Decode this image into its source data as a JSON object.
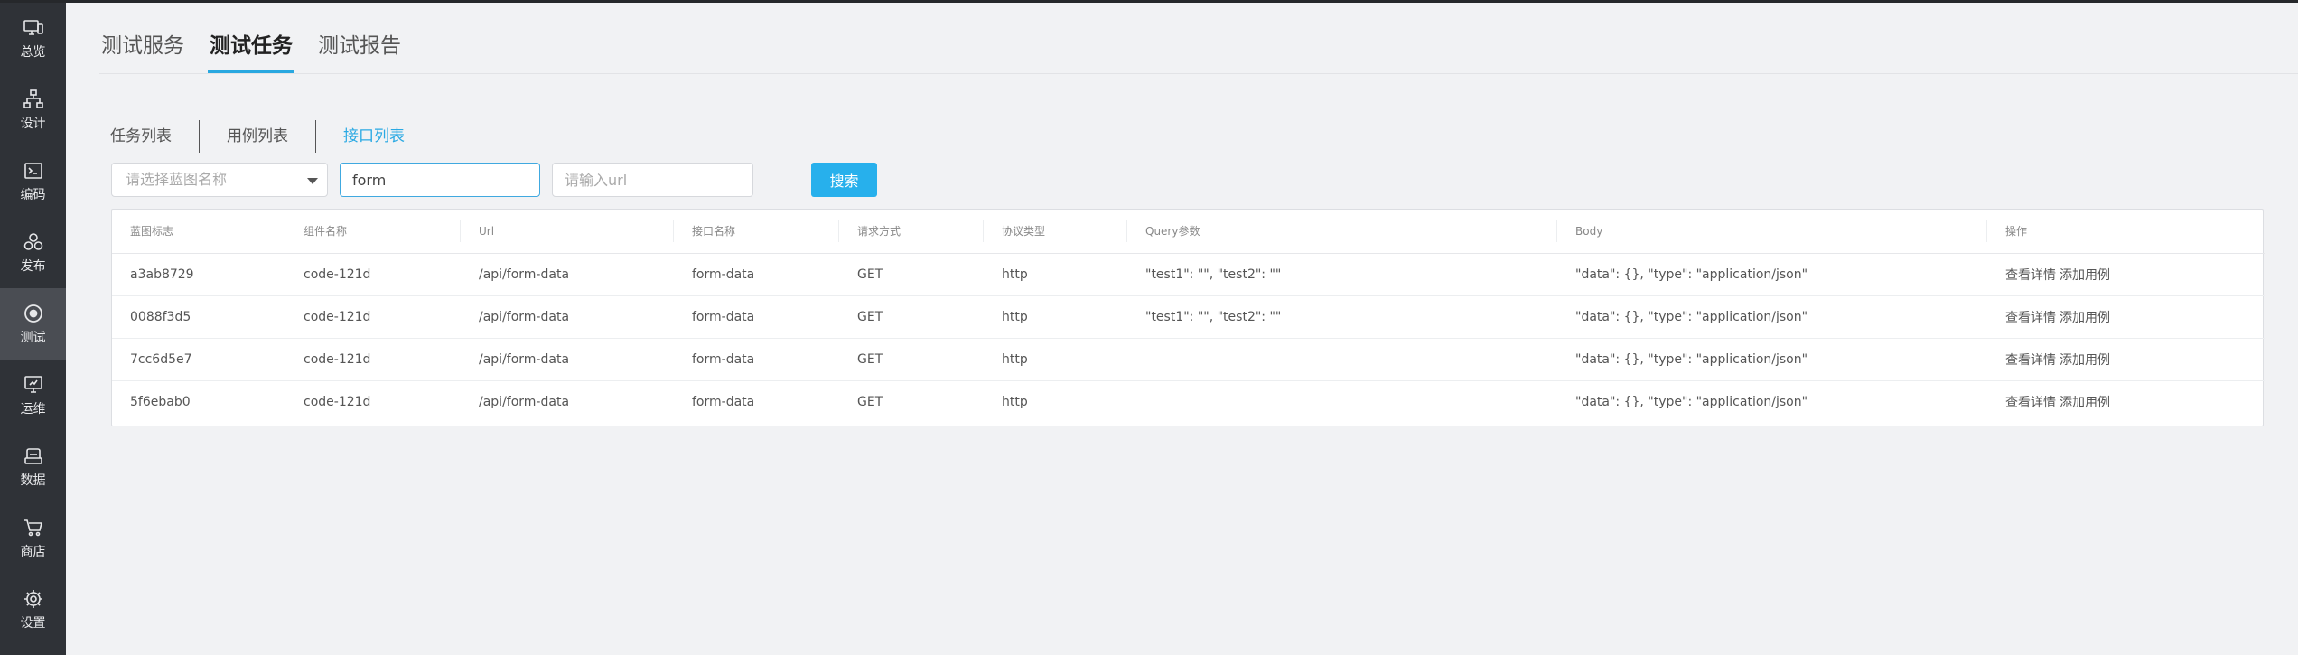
{
  "sidebar": {
    "items": [
      {
        "label": "总览",
        "icon": "monitor-icon"
      },
      {
        "label": "设计",
        "icon": "sitemap-icon"
      },
      {
        "label": "编码",
        "icon": "terminal-icon"
      },
      {
        "label": "发布",
        "icon": "circles-icon"
      },
      {
        "label": "测试",
        "icon": "target-icon"
      },
      {
        "label": "运维",
        "icon": "ops-monitor-icon"
      },
      {
        "label": "数据",
        "icon": "database-icon"
      },
      {
        "label": "商店",
        "icon": "cart-icon"
      },
      {
        "label": "设置",
        "icon": "gear-icon"
      }
    ],
    "active_index": 4
  },
  "top_tabs": [
    "测试服务",
    "测试任务",
    "测试报告"
  ],
  "sub_tabs": [
    "任务列表",
    "用例列表",
    "接口列表"
  ],
  "filters": {
    "blueprint_placeholder": "请选择蓝图名称",
    "keyword_value": "form",
    "url_placeholder": "请输入url",
    "search_label": "搜索"
  },
  "table": {
    "headers": [
      "蓝图标志",
      "组件名称",
      "Url",
      "接口名称",
      "请求方式",
      "协议类型",
      "Query参数",
      "Body",
      "操作"
    ],
    "rows": [
      [
        "a3ab8729",
        "code-121d",
        "/api/form-data",
        "form-data",
        "GET",
        "http",
        "\"test1\": \"\", \"test2\": \"\"",
        "\"data\": {}, \"type\": \"application/json\""
      ],
      [
        "0088f3d5",
        "code-121d",
        "/api/form-data",
        "form-data",
        "GET",
        "http",
        "\"test1\": \"\", \"test2\": \"\"",
        "\"data\": {}, \"type\": \"application/json\""
      ],
      [
        "7cc6d5e7",
        "code-121d",
        "/api/form-data",
        "form-data",
        "GET",
        "http",
        "",
        "\"data\": {}, \"type\": \"application/json\""
      ],
      [
        "5f6ebab0",
        "code-121d",
        "/api/form-data",
        "form-data",
        "GET",
        "http",
        "",
        "\"data\": {}, \"type\": \"application/json\""
      ]
    ],
    "actions": [
      "查看详情",
      "添加用例"
    ]
  }
}
